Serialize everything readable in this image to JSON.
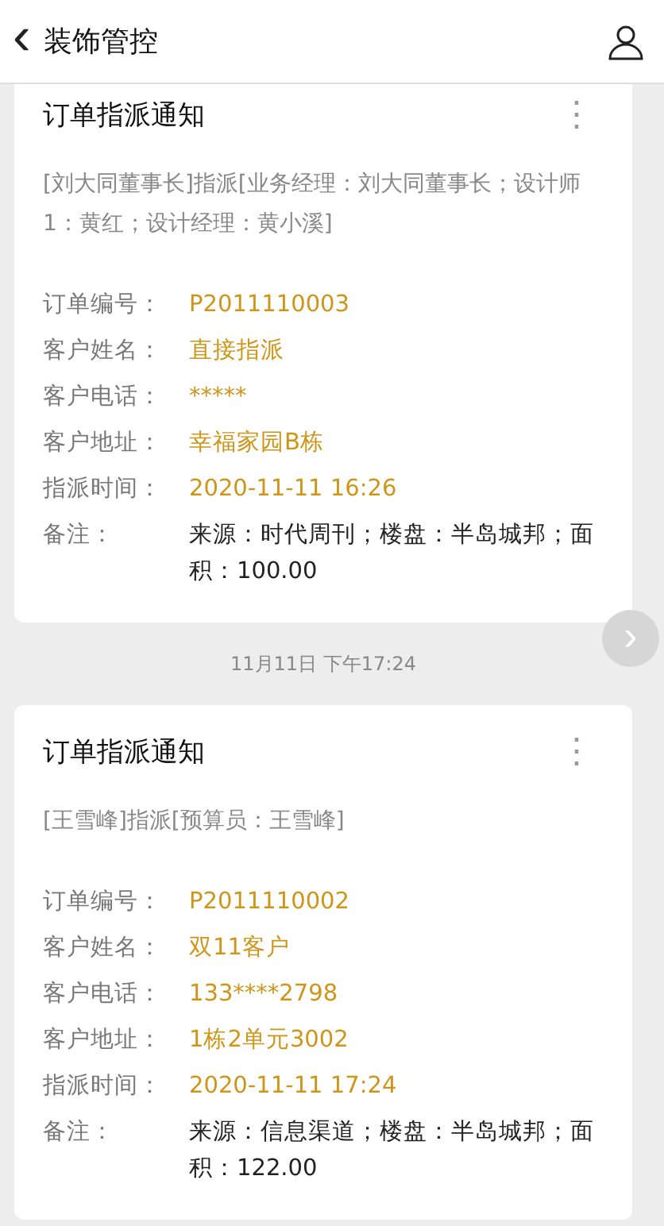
{
  "header": {
    "back": "‹",
    "title": "装饰管控"
  },
  "feed": [
    {
      "kind": "card",
      "title": "订单指派通知",
      "more": "⋮",
      "summary": "[刘大同董事长]指派[业务经理：刘大同董事长；设计师1：黄红；设计经理：黄小溪]",
      "fields": [
        {
          "label": "订单编号：",
          "value": "P2011110003",
          "kind": "highlight"
        },
        {
          "label": "客户姓名：",
          "value": "直接指派",
          "kind": "highlight"
        },
        {
          "label": "客户电话：",
          "value": "*****",
          "kind": "highlight"
        },
        {
          "label": "客户地址：",
          "value": "幸福家园B栋",
          "kind": "highlight"
        },
        {
          "label": "指派时间：",
          "value": "2020-11-11 16:26",
          "kind": "highlight"
        },
        {
          "label": "备注：",
          "value": "来源：时代周刊；楼盘：半岛城邦；面积：100.00",
          "kind": "plain"
        }
      ]
    },
    {
      "kind": "time",
      "text": "11月11日 下午17:24",
      "next": "›"
    },
    {
      "kind": "card",
      "title": "订单指派通知",
      "more": "⋮",
      "summary": "[王雪峰]指派[预算员：王雪峰]",
      "fields": [
        {
          "label": "订单编号：",
          "value": "P2011110002",
          "kind": "highlight"
        },
        {
          "label": "客户姓名：",
          "value": "双11客户",
          "kind": "highlight"
        },
        {
          "label": "客户电话：",
          "value": "133****2798",
          "kind": "highlight"
        },
        {
          "label": "客户地址：",
          "value": "1栋2单元3002",
          "kind": "highlight"
        },
        {
          "label": "指派时间：",
          "value": "2020-11-11 17:24",
          "kind": "highlight"
        },
        {
          "label": "备注：",
          "value": "来源：信息渠道；楼盘：半岛城邦；面积：122.00",
          "kind": "plain"
        }
      ]
    }
  ]
}
